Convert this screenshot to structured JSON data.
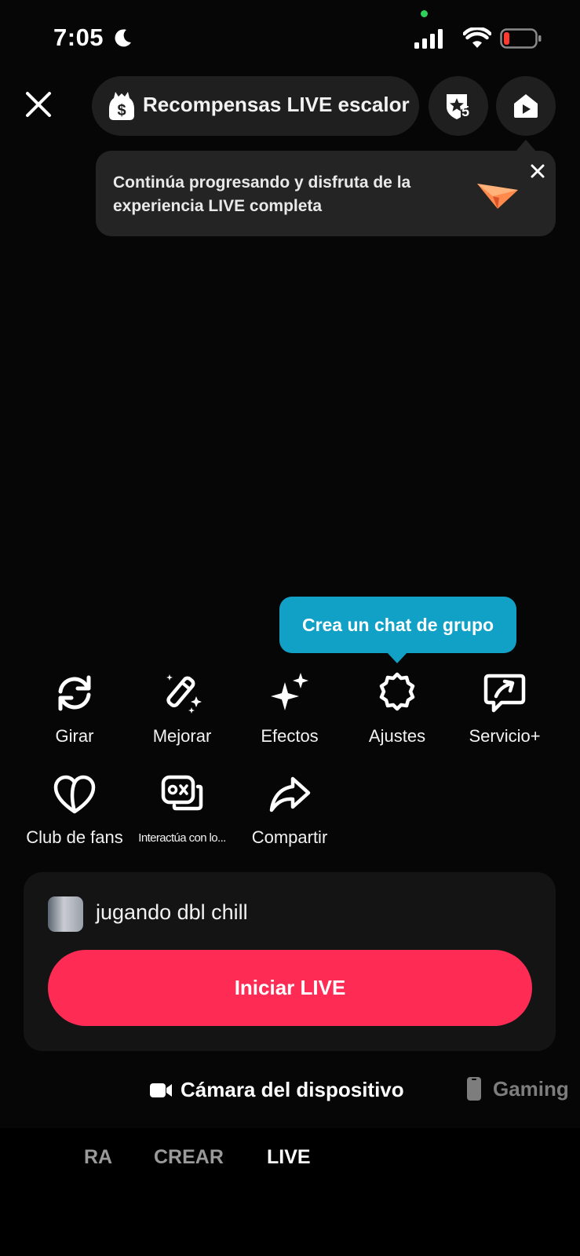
{
  "status_bar": {
    "time": "7:05",
    "icons": [
      "moon-icon",
      "signal-icon",
      "wifi-icon",
      "battery-low-icon"
    ],
    "battery_color": "#ff3b30"
  },
  "top_bar": {
    "rewards_label": "Recompensas LIVE escalor",
    "rank_badge": "5",
    "icons": [
      "close-icon",
      "dollar-bag-icon",
      "rank-badge-icon",
      "broadcast-icon"
    ]
  },
  "tooltip_top": {
    "text": "Continúa progresando y disfruta de la experiencia LIVE completa",
    "icon": "paper-plane-icon"
  },
  "tooltip_chat": {
    "text": "Crea un chat de grupo",
    "color": "#12a1c6"
  },
  "tools": [
    {
      "label": "Girar",
      "icon": "rotate-icon"
    },
    {
      "label": "Mejorar",
      "icon": "magic-wand-icon"
    },
    {
      "label": "Efectos",
      "icon": "sparkles-icon"
    },
    {
      "label": "Ajustes",
      "icon": "settings-gear-icon"
    },
    {
      "label": "Servicio+",
      "icon": "service-plus-icon"
    },
    {
      "label": "Club de fans",
      "icon": "heart-club-icon"
    },
    {
      "label": "Interactúa con lo...",
      "icon": "game-controller-icon"
    },
    {
      "label": "Compartir",
      "icon": "share-arrow-icon"
    }
  ],
  "panel": {
    "stream_title": "jugando dbl chill",
    "start_button": "Iniciar LIVE",
    "start_color": "#fe2c55"
  },
  "sources": {
    "camera": "Cámara del dispositivo",
    "gaming": "Gaming"
  },
  "modes": {
    "partial_left": "RA",
    "crear": "CREAR",
    "live": "LIVE"
  }
}
